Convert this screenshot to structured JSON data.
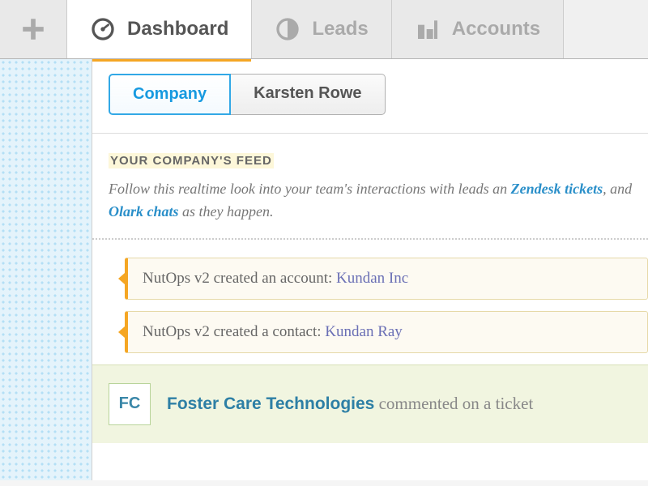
{
  "nav": {
    "tabs": [
      {
        "label": "Dashboard",
        "active": true
      },
      {
        "label": "Leads",
        "active": false
      },
      {
        "label": "Accounts",
        "active": false
      }
    ]
  },
  "segment": {
    "company_label": "Company",
    "person_label": "Karsten Rowe"
  },
  "feed": {
    "title": "YOUR COMPANY'S FEED",
    "desc_pre": "Follow this realtime look into your team's interactions with leads an",
    "desc_link1": "Zendesk tickets",
    "desc_sep": ", and ",
    "desc_link2": "Olark chats",
    "desc_post": " as they happen."
  },
  "items": [
    {
      "actor": "NutOps v2",
      "verb": " created an account: ",
      "object": "Kundan Inc"
    },
    {
      "actor": "NutOps v2",
      "verb": " created a contact: ",
      "object": "Kundan Ray"
    }
  ],
  "comment": {
    "initials": "FC",
    "company": "Foster Care Technologies",
    "tail": " commented on a ticket"
  }
}
